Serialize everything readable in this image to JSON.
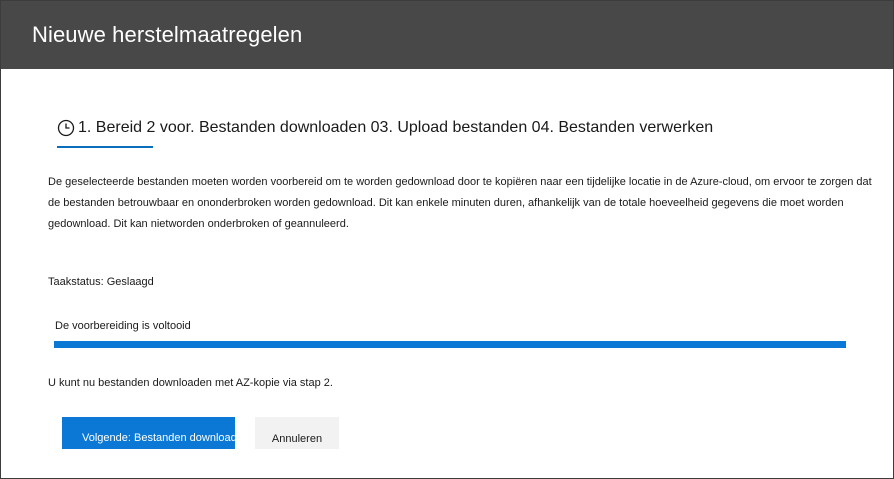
{
  "dialog": {
    "title": "Nieuwe herstelmaatregelen"
  },
  "steps": {
    "icon": "clock-icon",
    "text": "1. Bereid 2 voor. Bestanden downloaden 03. Upload bestanden 04. Bestanden verwerken"
  },
  "description": "De geselecteerde bestanden moeten worden voorbereid om te worden gedownload door te kopiëren naar een tijdelijke locatie in de Azure-cloud, om ervoor te zorgen dat de bestanden betrouwbaar en ononderbroken worden gedownload. Dit kan enkele minuten duren, afhankelijk van de totale hoeveelheid gegevens die moet worden gedownload. Dit kan nietworden onderbroken of geannuleerd.",
  "task_status": "Taakstatus: Geslaagd",
  "progress": {
    "label": "De voorbereiding is voltooid",
    "percent": 100
  },
  "info": "U kunt nu bestanden downloaden met AZ-kopie via stap 2.",
  "buttons": {
    "next": "Volgende: Bestanden downloaden",
    "cancel": "Annuleren"
  },
  "colors": {
    "titlebar": "#484848",
    "accent": "#0a78d4"
  }
}
